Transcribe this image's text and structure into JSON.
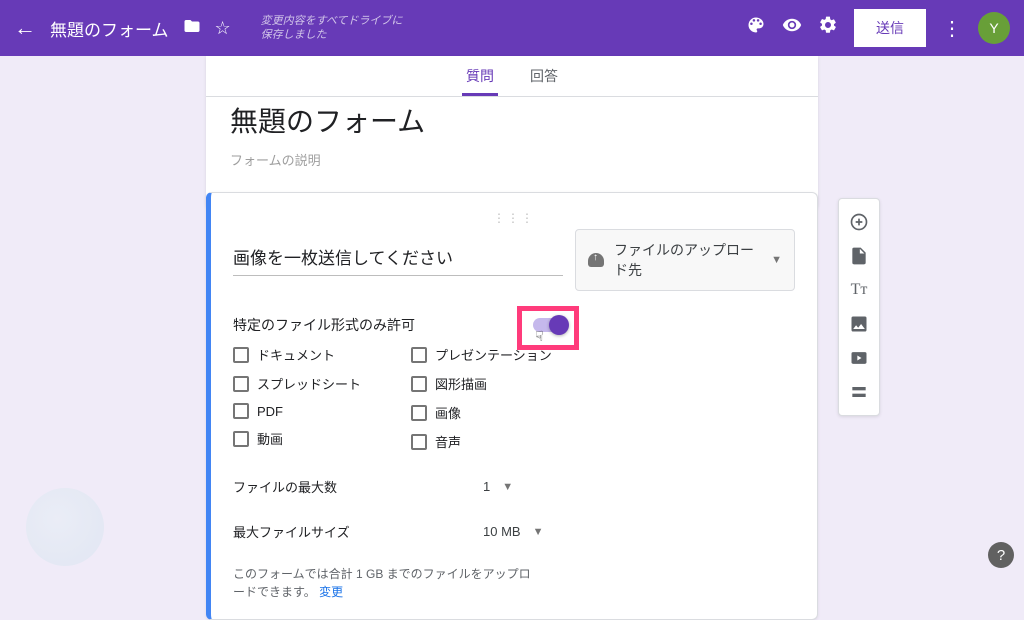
{
  "header": {
    "title": "無題のフォーム",
    "saved_text": "変更内容をすべてドライブに保存しました",
    "send_label": "送信",
    "avatar_letter": "Y"
  },
  "tabs": {
    "questions": "質問",
    "responses": "回答"
  },
  "form": {
    "title": "無題のフォーム",
    "description_placeholder": "フォームの説明"
  },
  "question": {
    "title": "画像を一枚送信してください",
    "type_label": "ファイルのアップロード先",
    "allow_specific_label": "特定のファイル形式のみ許可",
    "file_types": {
      "col1": [
        "ドキュメント",
        "スプレッドシート",
        "PDF",
        "動画"
      ],
      "col2": [
        "プレゼンテーション",
        "図形描画",
        "画像",
        "音声"
      ]
    },
    "max_files_label": "ファイルの最大数",
    "max_files_value": "1",
    "max_size_label": "最大ファイルサイズ",
    "max_size_value": "10 MB",
    "upload_note": "このフォームでは合計 1 GB までのファイルをアップロードできます。",
    "change_link": "変更"
  }
}
